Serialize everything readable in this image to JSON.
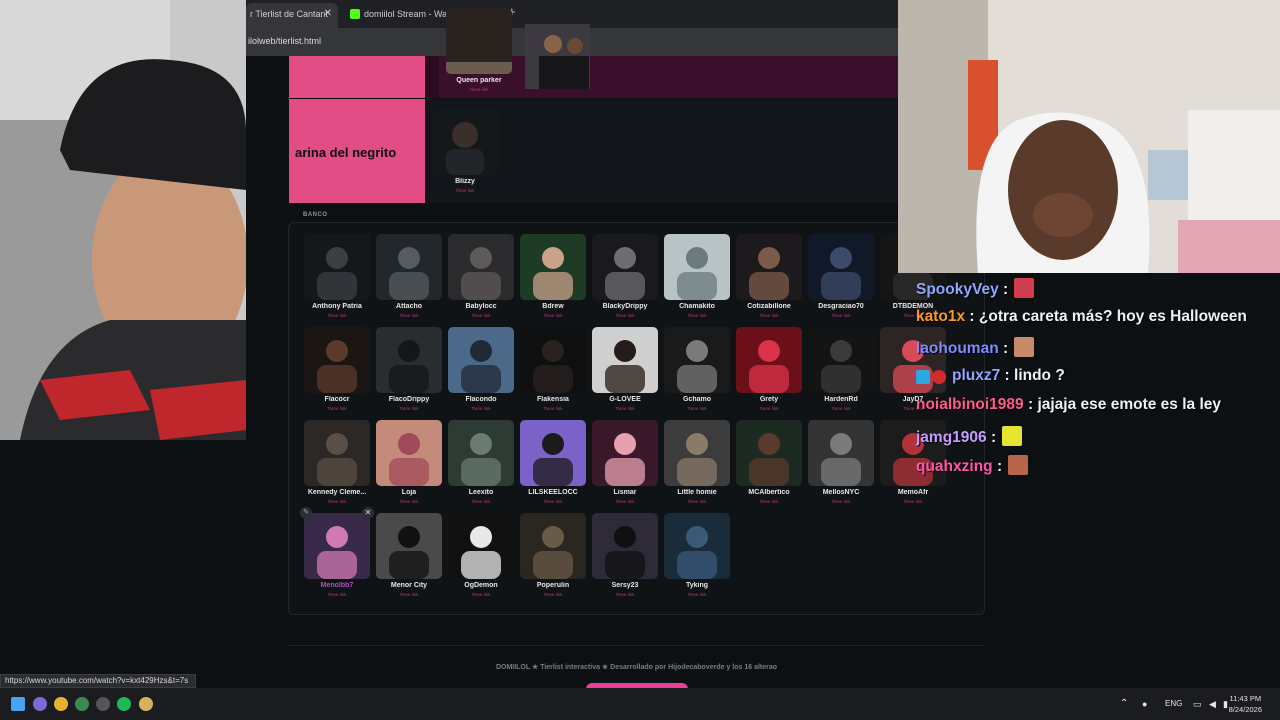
{
  "browser": {
    "tab1_title": "r Tierlist de Cantant",
    "tab2_title": "domiilol Stream - Watch Live o",
    "close_glyph": "✕",
    "new_tab_glyph": "+",
    "url": "ilolweb/tierlist.html"
  },
  "tiers": [
    {
      "label": "",
      "cards": [
        {
          "name": "Queen parker",
          "sub": "Tiene link"
        }
      ]
    },
    {
      "label": "arina del negrito",
      "cards": [
        {
          "name": "Blizzy",
          "sub": "Tiene link"
        }
      ]
    }
  ],
  "banco": {
    "title": "BANCO",
    "cards": [
      {
        "name": "Anthony Patria",
        "sub": "Tiene link"
      },
      {
        "name": "Attacho",
        "sub": "Tiene link"
      },
      {
        "name": "Babylocc",
        "sub": "Tiene link"
      },
      {
        "name": "Bdrew",
        "sub": "Tiene link"
      },
      {
        "name": "BlackyDrippy",
        "sub": "Tiene link"
      },
      {
        "name": "Chamakito",
        "sub": "Tiene link"
      },
      {
        "name": "Cotizabillone",
        "sub": "Tiene link"
      },
      {
        "name": "Desgraciao70",
        "sub": "Tiene link"
      },
      {
        "name": "DTBDEMON",
        "sub": "Tiene link"
      },
      {
        "name": "Flacocr",
        "sub": "Tiene link"
      },
      {
        "name": "FlacoDrippy",
        "sub": "Tiene link"
      },
      {
        "name": "Flacondo",
        "sub": "Tiene link"
      },
      {
        "name": "Flakensia",
        "sub": "Tiene link"
      },
      {
        "name": "G-LOVEE",
        "sub": "Tiene link"
      },
      {
        "name": "Gchamo",
        "sub": "Tiene link"
      },
      {
        "name": "Grety",
        "sub": "Tiene link"
      },
      {
        "name": "HardenRd",
        "sub": "Tiene link"
      },
      {
        "name": "JayD7",
        "sub": "Tiene link"
      },
      {
        "name": "Kennedy Cleme...",
        "sub": "Tiene link"
      },
      {
        "name": "Loja",
        "sub": "Tiene link"
      },
      {
        "name": "Leexito",
        "sub": "Tiene link"
      },
      {
        "name": "LILSKEELOCC",
        "sub": "Tiene link"
      },
      {
        "name": "Lismar",
        "sub": "Tiene link"
      },
      {
        "name": "Little homie",
        "sub": "Tiene link"
      },
      {
        "name": "MCAlbertico",
        "sub": "Tiene link"
      },
      {
        "name": "MellosNYC",
        "sub": "Tiene link"
      },
      {
        "name": "MemoAfr",
        "sub": "Tiene link"
      },
      {
        "name": "Menolbb7",
        "sub": "Tiene link"
      },
      {
        "name": "Menor City",
        "sub": "Tiene link"
      },
      {
        "name": "OgDemon",
        "sub": "Tiene link"
      },
      {
        "name": "Poperulin",
        "sub": "Tiene link"
      },
      {
        "name": "Sersy23",
        "sub": "Tiene link"
      },
      {
        "name": "Tyking",
        "sub": "Tiene link"
      }
    ]
  },
  "footer": "DOMIILOL ★ Tierlist interactiva ★ Desarrollado por Hijodecaboverde y los 16 alterao",
  "chat": [
    {
      "user": "SpookyVey",
      "text": " :",
      "color": "#8ea7ff"
    },
    {
      "user": "kato1x",
      "text": " : ¿otra careta más? hoy es Halloween",
      "color": "#ff9a1f"
    },
    {
      "user": "laohouman",
      "text": " :",
      "color": "#7f8cff"
    },
    {
      "user": "pluxz7",
      "text": " : lindo ?",
      "color": "#8ea7ff"
    },
    {
      "user": "noialbinoi1989",
      "text": " : jajaja ese emote es la ley",
      "color": "#ff5c8a"
    },
    {
      "user": "jamg1906",
      "text": " :",
      "color": "#c59cff"
    },
    {
      "user": "quahxzing",
      "text": " :",
      "color": "#ff57a8"
    }
  ],
  "status_url": "https://www.youtube.com/watch?v=kxt429Hzs&t=7s",
  "taskbar": {
    "lang": "ENG",
    "time": "11:43 PM",
    "date": "8/24/2026"
  },
  "colors": {
    "tier_pink": "#d63a76",
    "page_bg": "#0d1013",
    "accent_pink": "#ea3f95"
  }
}
